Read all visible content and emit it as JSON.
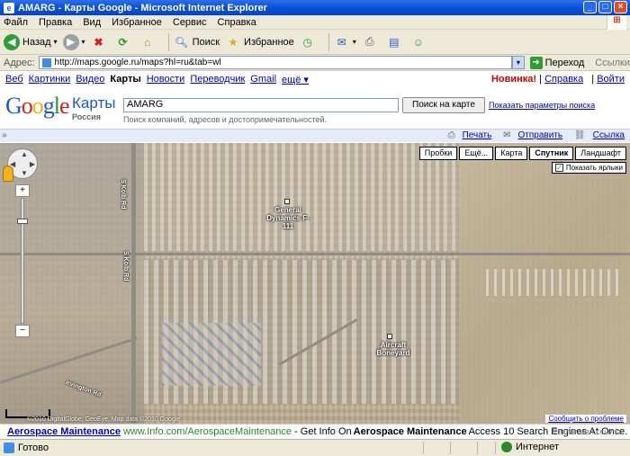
{
  "window": {
    "title": "AMARG - Карты Google - Microsoft Internet Explorer"
  },
  "menu": [
    "Файл",
    "Правка",
    "Вид",
    "Избранное",
    "Сервис",
    "Справка"
  ],
  "toolbar": {
    "back": "Назад",
    "search": "Поиск",
    "favorites": "Избранное"
  },
  "address": {
    "label": "Адрес:",
    "url": "http://maps.google.ru/maps?hl=ru&tab=wl",
    "go": "Переход",
    "links": "Ссылки"
  },
  "gnav": {
    "items": [
      "Веб",
      "Картинки",
      "Видео",
      "Карты",
      "Новости",
      "Переводчик",
      "Gmail",
      "ещё ▾"
    ],
    "active": "Карты",
    "right_new": "Новинка!",
    "right_help": "Справка",
    "right_login": "Войти"
  },
  "header": {
    "product": "Карты",
    "region": "Россия",
    "query": "AMARG",
    "hint": "Поиск компаний, адресов и достопримечательностей.",
    "search_button": "Поиск на карте",
    "options_link": "Показать параметры поиска"
  },
  "actions": {
    "print": "Печать",
    "send": "Отправить",
    "link": "Ссылка"
  },
  "map": {
    "buttons": [
      "Пробки",
      "Ещё...",
      "Карта",
      "Спутник",
      "Ландшафт"
    ],
    "active_button": "Спутник",
    "show_labels": "Показать ярлыки",
    "labels": {
      "dynamics": "General Dynamics F-111",
      "boneyard": "Aircraft Boneyard",
      "road1": "S Kolb Rd",
      "road2": "S Kolb Rd",
      "road3": "Irvington Rd"
    },
    "copyright": "©2010 DigitalGlobe, GeoEye, Map data ©2010 Google",
    "report": "Сообщить о проблеме"
  },
  "ad": {
    "title": "Aerospace Maintenance",
    "url": "www.Info.com/AerospaceMaintenance",
    "desc_prefix": "- Get Info On ",
    "desc_bold": "Aerospace Maintenance",
    "desc_suffix": " Access 10 Search Engines At Once.",
    "label": "Рекламная ссылка"
  },
  "status": {
    "text": "Готово",
    "zone": "Интернет"
  }
}
